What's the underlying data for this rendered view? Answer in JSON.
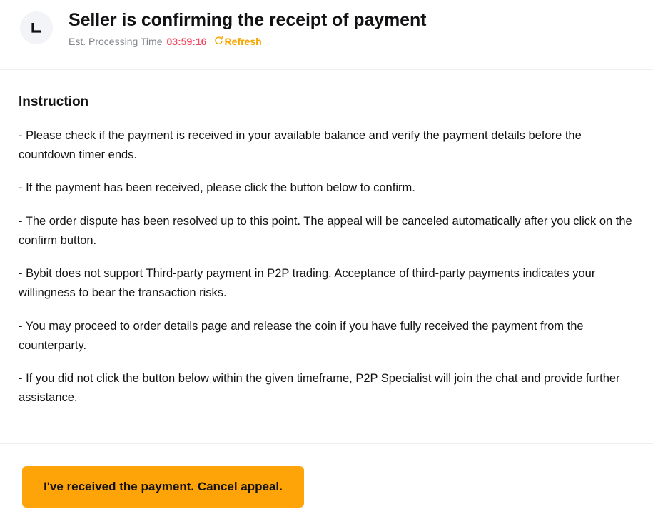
{
  "header": {
    "icon": "clock-icon",
    "title": "Seller is confirming the receipt of payment",
    "est_label": "Est. Processing Time",
    "countdown": "03:59:16",
    "refresh_icon": "refresh-icon",
    "refresh_label": "Refresh"
  },
  "instructions": {
    "title": "Instruction",
    "items": [
      "- Please check if the payment is received in your available balance and verify the payment details before the countdown timer ends.",
      "- If the payment has been received, please click the button below to confirm.",
      "- The order dispute has been resolved up to this point. The appeal will be canceled automatically after you click on the confirm button.",
      "- Bybit does not support Third-party payment in P2P trading. Acceptance of third-party payments indicates your willingness to bear the transaction risks.",
      "- You may proceed to order details page and release the coin if you have fully received the payment from the counterparty.",
      "- If you did not click the button below within the given timeframe, P2P Specialist will join the chat and provide further assistance."
    ]
  },
  "footer": {
    "confirm_label": "I've received the payment. Cancel appeal."
  },
  "colors": {
    "accent": "#ffa408",
    "countdown": "#f6465d",
    "refresh": "#f7a600",
    "muted_text": "#81858c",
    "text": "#121214"
  }
}
